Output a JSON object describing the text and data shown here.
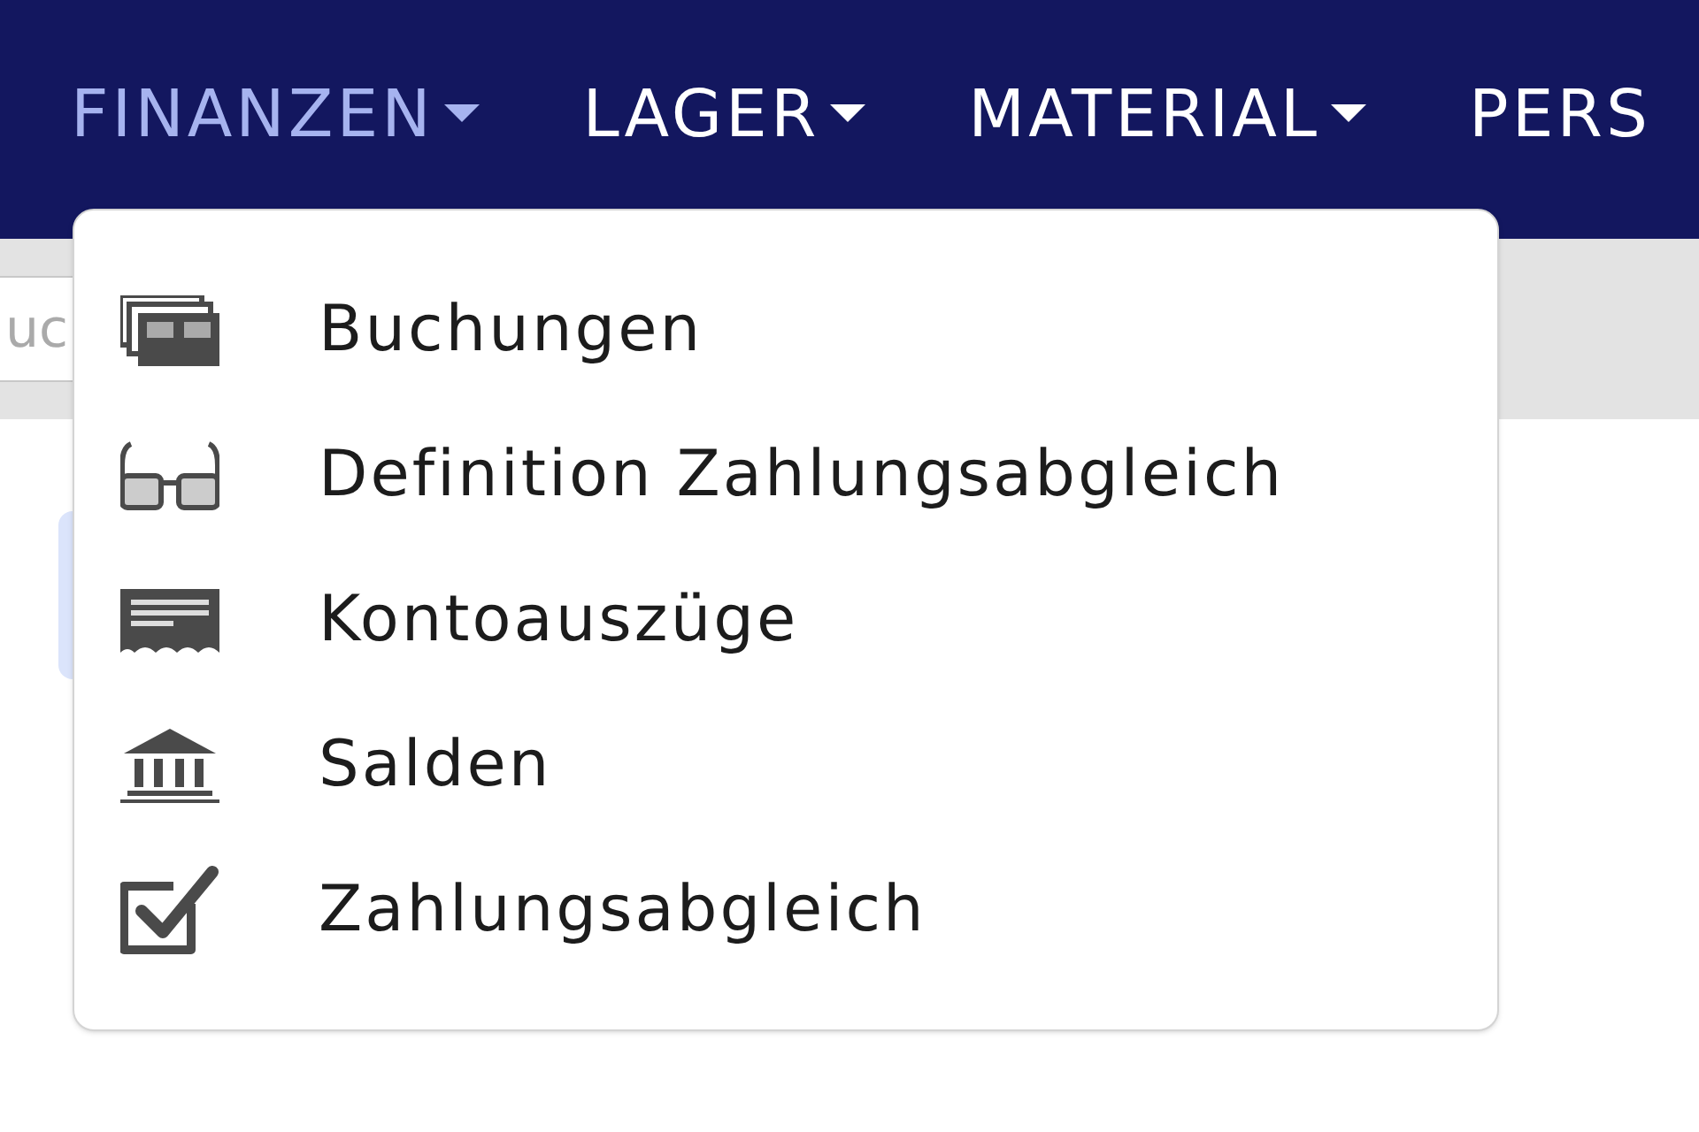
{
  "nav": [
    {
      "label": "FINANZEN",
      "selected": true,
      "caret": true
    },
    {
      "label": "LAGER",
      "selected": false,
      "caret": true
    },
    {
      "label": "MATERIAL",
      "selected": false,
      "caret": true
    },
    {
      "label": "PERS",
      "selected": false,
      "caret": false
    }
  ],
  "search": {
    "placeholder": "uc"
  },
  "menu": {
    "items": [
      {
        "label": "Buchungen",
        "kind": "cards"
      },
      {
        "label": "Definition Zahlungsabgleich",
        "kind": "glasses"
      },
      {
        "label": "Kontoauszüge",
        "kind": "ticket"
      },
      {
        "label": "Salden",
        "kind": "bank"
      },
      {
        "label": "Zahlungsabgleich",
        "kind": "check"
      }
    ]
  }
}
